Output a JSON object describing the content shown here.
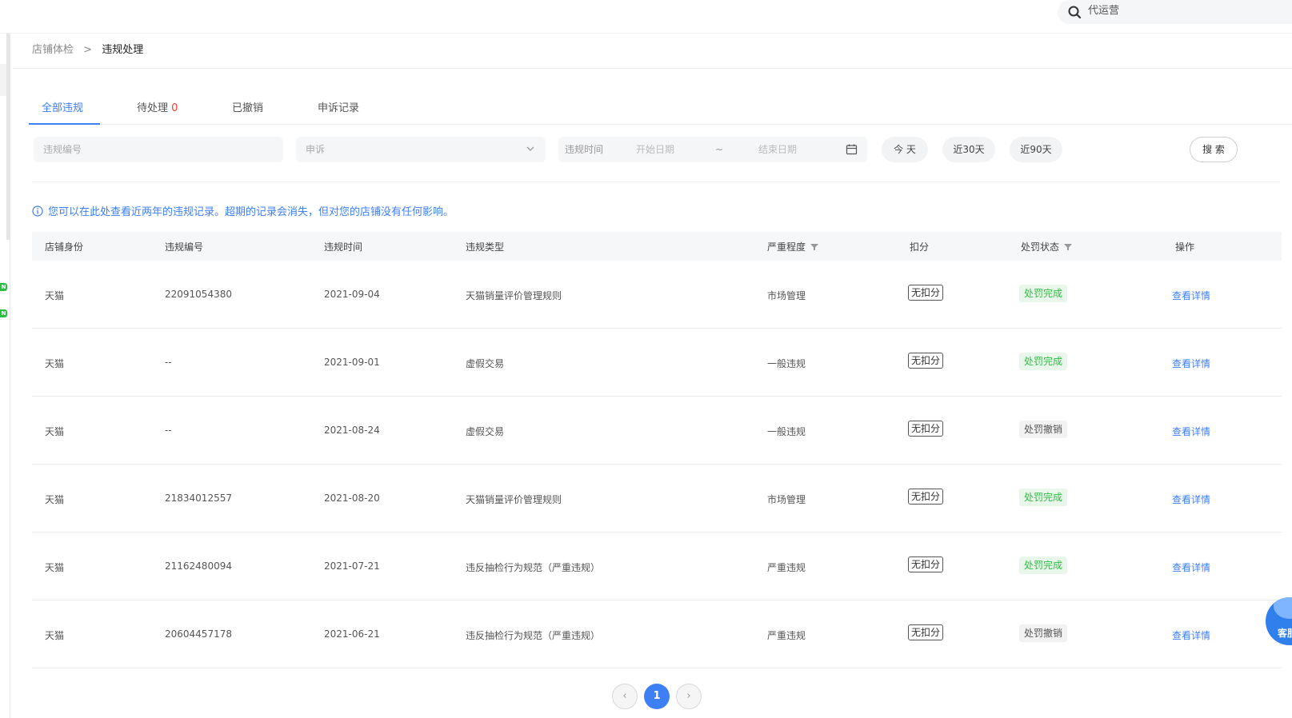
{
  "topbar": {
    "search_text": "代运营"
  },
  "sidebar": {
    "badges": [
      "N",
      "N"
    ]
  },
  "breadcrumb": {
    "parent": "店铺体检",
    "separator": ">",
    "current": "违规处理"
  },
  "tabs": [
    {
      "label": "全部违规"
    },
    {
      "label": "待处理",
      "count": "0"
    },
    {
      "label": "已撤销"
    },
    {
      "label": "申诉记录"
    }
  ],
  "filters": {
    "violation_id_placeholder": "违规编号",
    "appeal_select_value": "申诉",
    "date_label": "违规时间",
    "start_placeholder": "开始日期",
    "tilde": "~",
    "end_placeholder": "结束日期",
    "quick": [
      "今 天",
      "近30天",
      "近90天"
    ],
    "search_label": "搜 索"
  },
  "notice": "您可以在此处查看近两年的违规记录。超期的记录会消失，但对您的店铺没有任何影响。",
  "table": {
    "headers": [
      "店铺身份",
      "违规编号",
      "违规时间",
      "违规类型",
      "严重程度",
      "扣分",
      "处罚状态",
      "操作"
    ],
    "rows": [
      {
        "shop": "天猫",
        "id": "22091054380",
        "date": "2021-09-04",
        "type": "天猫销量评价管理规则",
        "severity": "市场管理",
        "deduct": "无扣分",
        "status": "处罚完成",
        "status_kind": "done",
        "action": "查看详情"
      },
      {
        "shop": "天猫",
        "id": "--",
        "date": "2021-09-01",
        "type": "虚假交易",
        "severity": "一般违规",
        "deduct": "无扣分",
        "status": "处罚完成",
        "status_kind": "done",
        "action": "查看详情"
      },
      {
        "shop": "天猫",
        "id": "--",
        "date": "2021-08-24",
        "type": "虚假交易",
        "severity": "一般违规",
        "deduct": "无扣分",
        "status": "处罚撤销",
        "status_kind": "revoked",
        "action": "查看详情"
      },
      {
        "shop": "天猫",
        "id": "21834012557",
        "date": "2021-08-20",
        "type": "天猫销量评价管理规则",
        "severity": "市场管理",
        "deduct": "无扣分",
        "status": "处罚完成",
        "status_kind": "done",
        "action": "查看详情"
      },
      {
        "shop": "天猫",
        "id": "21162480094",
        "date": "2021-07-21",
        "type": "违反抽检行为规范（严重违规）",
        "severity": "严重违规",
        "deduct": "无扣分",
        "status": "处罚完成",
        "status_kind": "done",
        "action": "查看详情"
      },
      {
        "shop": "天猫",
        "id": "20604457178",
        "date": "2021-06-21",
        "type": "违反抽检行为规范（严重违规）",
        "severity": "严重违规",
        "deduct": "无扣分",
        "status": "处罚撤销",
        "status_kind": "revoked",
        "action": "查看详情"
      }
    ]
  },
  "pagination": {
    "prev": "‹",
    "current_page": "1",
    "next": "›"
  },
  "widget": {
    "label": "客服"
  },
  "colors": {
    "accent": "#3d7ff5",
    "success": "#2ebd43",
    "danger": "#ff3b30"
  }
}
